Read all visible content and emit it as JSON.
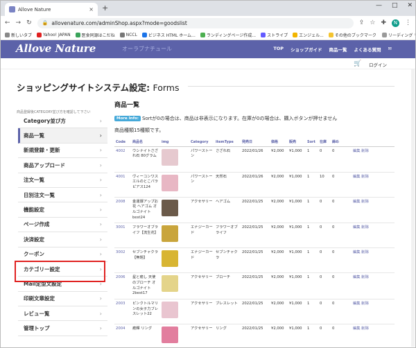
{
  "browser": {
    "tab_title": "Allove Nature",
    "tab_close": "×",
    "new_tab": "+",
    "window_controls": [
      "—",
      "□",
      "✕"
    ],
    "url": "allovenature.com/adminShop.aspx?mode=goodslist",
    "bookmarks": [
      "新しいタブ",
      "Yahoo! JAPAN",
      "医食同源はこだね",
      "NCCL",
      "ビジネス HTML ホーム...",
      "ランディングページ作成...",
      "ストライプ",
      "エンジェル...",
      "その他のブックマーク",
      "リーディング リスト"
    ],
    "avatar_letter": "N"
  },
  "site": {
    "logo": "Allove Nature",
    "logo_sub": "オーラブナチュール",
    "nav": [
      "TOP",
      "ショップガイド",
      "商品一覧",
      "よくある質問"
    ],
    "login": "ログイン"
  },
  "page": {
    "title": "ショッピングサイトシステム設定:",
    "title_suffix": "Forms",
    "sidebar_note": "商品登録後CATEGORY並び方を確認して下さい",
    "sidebar": [
      "Category並び方",
      "商品一覧",
      "新規登録・更新",
      "商品アップロード",
      "注文一覧",
      "日別注文一覧",
      "機能設定",
      "ページ作成",
      "決済設定",
      "クーポン",
      "カテゴリー設定",
      "Mail定型文設定",
      "印刷文章設定",
      "レビュー覧",
      "管理トップ"
    ],
    "active_index": 1,
    "section_title": "商品一覧",
    "info_badge": "More Info:",
    "info_text": "Sortが0の場合は、商品は非表示になります。在庫が0の場合は、購入ボタンが押せません",
    "count_text": "商品種類15種類です。"
  },
  "table": {
    "headers": [
      "Code",
      "商品名",
      "img",
      "Category",
      "itemType",
      "発売日",
      "価格",
      "販売",
      "Sort",
      "在庫",
      "締め",
      ""
    ],
    "rows": [
      {
        "code": "4002",
        "name": "ウシナイトさざれ石 80グラム",
        "cat": "パワーストーン",
        "type": "さざれ石",
        "date": "2022/01/26",
        "price": "¥2,000",
        "sale": "¥1,000",
        "sort": "1",
        "stock": "0",
        "close": "0",
        "edit": "編集",
        "del": "削除",
        "img": "#e6c9cf"
      },
      {
        "code": "4001",
        "name": "ヴィーコンワスエルのとこパラピアス124",
        "cat": "パワーストーン",
        "type": "天然石",
        "date": "2022/01/26",
        "price": "¥2,000",
        "sale": "¥1,000",
        "sort": "1",
        "stock": "10",
        "close": "0",
        "edit": "編集",
        "del": "削除",
        "img": "#e8b7c4"
      },
      {
        "code": "2008",
        "name": "金運爆アップお花 ヘアゴム オルゴナイト best24",
        "cat": "アクセサリー",
        "type": "ヘアゴム",
        "date": "2022/01/25",
        "price": "¥2,000",
        "sale": "¥1,000",
        "sort": "1",
        "stock": "0",
        "close": "0",
        "edit": "編集",
        "del": "削除",
        "img": "#6b5a4a"
      },
      {
        "code": "3001",
        "name": "フラワーオブライフ【流生花】",
        "cat": "エナジーカード",
        "type": "フラワーオブライフ",
        "date": "2022/01/25",
        "price": "¥2,000",
        "sale": "¥1,000",
        "sort": "1",
        "stock": "0",
        "close": "0",
        "edit": "編集",
        "del": "削除",
        "img": "#c9a53c"
      },
      {
        "code": "3002",
        "name": "セブンチャクラ【無題】",
        "cat": "エナジーカード",
        "type": "セブンチャクラ",
        "date": "2022/01/25",
        "price": "¥2,000",
        "sale": "¥1,000",
        "sort": "1",
        "stock": "0",
        "close": "0",
        "edit": "編集",
        "del": "削除",
        "img": "#d8b532"
      },
      {
        "code": "2006",
        "name": "星と癒し 天使のブローチ オルゴナイト2best17",
        "cat": "アクセサリー",
        "type": "ブローチ",
        "date": "2022/01/25",
        "price": "¥2,000",
        "sale": "¥1,000",
        "sort": "1",
        "stock": "0",
        "close": "0",
        "edit": "編集",
        "del": "削除",
        "img": "#e4d48a"
      },
      {
        "code": "2003",
        "name": "ピンクトルマリンの女子力ブレスレット22",
        "cat": "アクセサリー",
        "type": "ブレスレット",
        "date": "2022/01/25",
        "price": "¥2,000",
        "sale": "¥1,000",
        "sort": "1",
        "stock": "0",
        "close": "0",
        "edit": "編集",
        "del": "削除",
        "img": "#e9c5d0"
      },
      {
        "code": "2004",
        "name": "癒輝 リング",
        "cat": "アクセサリー",
        "type": "リング",
        "date": "2022/01/25",
        "price": "¥2,000",
        "sale": "¥1,000",
        "sort": "1",
        "stock": "0",
        "close": "0",
        "edit": "編集",
        "del": "削除",
        "img": "#e27e9e"
      }
    ]
  },
  "colors": {
    "brand": "#5c62a9",
    "highlight": "#e0201f",
    "badge": "#45a9d9"
  }
}
